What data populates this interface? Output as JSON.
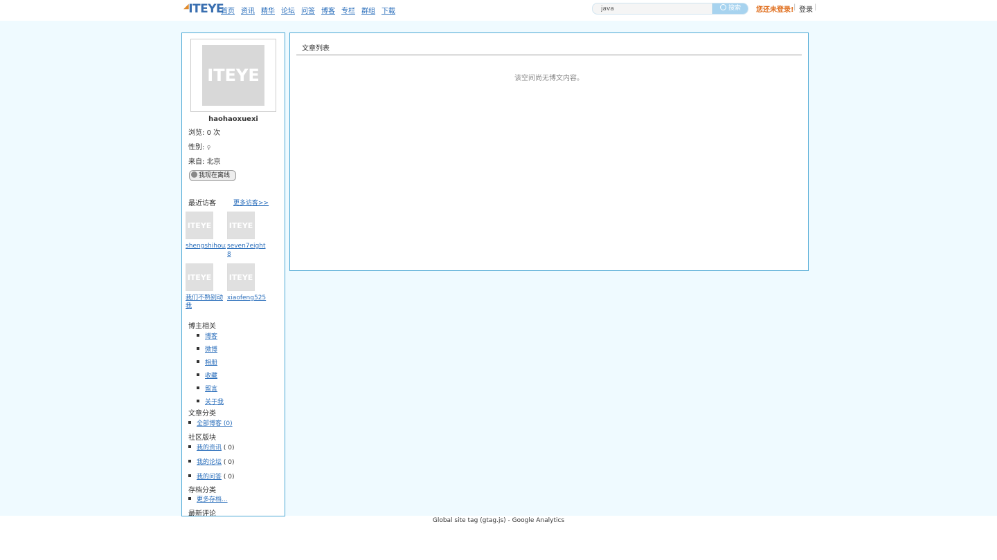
{
  "header": {
    "logo": "ITEYE",
    "nav": [
      "首页",
      "资讯",
      "精华",
      "论坛",
      "问答",
      "博客",
      "专栏",
      "群组",
      "下载"
    ],
    "search_value": "java",
    "search_button": "搜索",
    "not_logged_in": "您还未登录!",
    "separator": "|",
    "login": "登录"
  },
  "sidebar": {
    "username": "haohaoxuexi",
    "views_label": "浏览: ",
    "views_value": "0",
    "views_unit": " 次",
    "gender_label": "性别: ",
    "gender_icon": "female-icon",
    "from_label": "来自: ",
    "from_value": "北京",
    "status": "我现在离线",
    "recent_visitors_title": "最近访客",
    "more_visitors": "更多访客>>",
    "visitors": [
      {
        "name": "shengshihouzhe"
      },
      {
        "name": "seven7eight8"
      },
      {
        "name": "我们不熟别动我"
      },
      {
        "name": "xiaofeng525"
      }
    ],
    "blogger_title": "博主相关",
    "blogger_links": [
      "博客",
      "微博",
      "相册",
      "收藏",
      "留言",
      "关于我"
    ],
    "category_title": "文章分类",
    "categories": [
      {
        "label": "全部博客 (0)"
      }
    ],
    "community_title": "社区版块",
    "community": [
      {
        "label": "我的资讯",
        "count": "( 0)"
      },
      {
        "label": "我的论坛",
        "count": "( 0)"
      },
      {
        "label": "我的问答",
        "count": "( 0)"
      }
    ],
    "archive_title": "存档分类",
    "archive_more": "更多存档...",
    "latest_comments_title": "最新评论"
  },
  "main": {
    "title": "文章列表",
    "empty_message": "该空间尚无博文内容。"
  },
  "footer": {
    "text": "Global site tag (gtag.js) - Google Analytics"
  },
  "colors": {
    "page_bg": "#effaff",
    "border": "#4aa7d4",
    "link": "#2a6ebb",
    "alert": "#e07020"
  }
}
